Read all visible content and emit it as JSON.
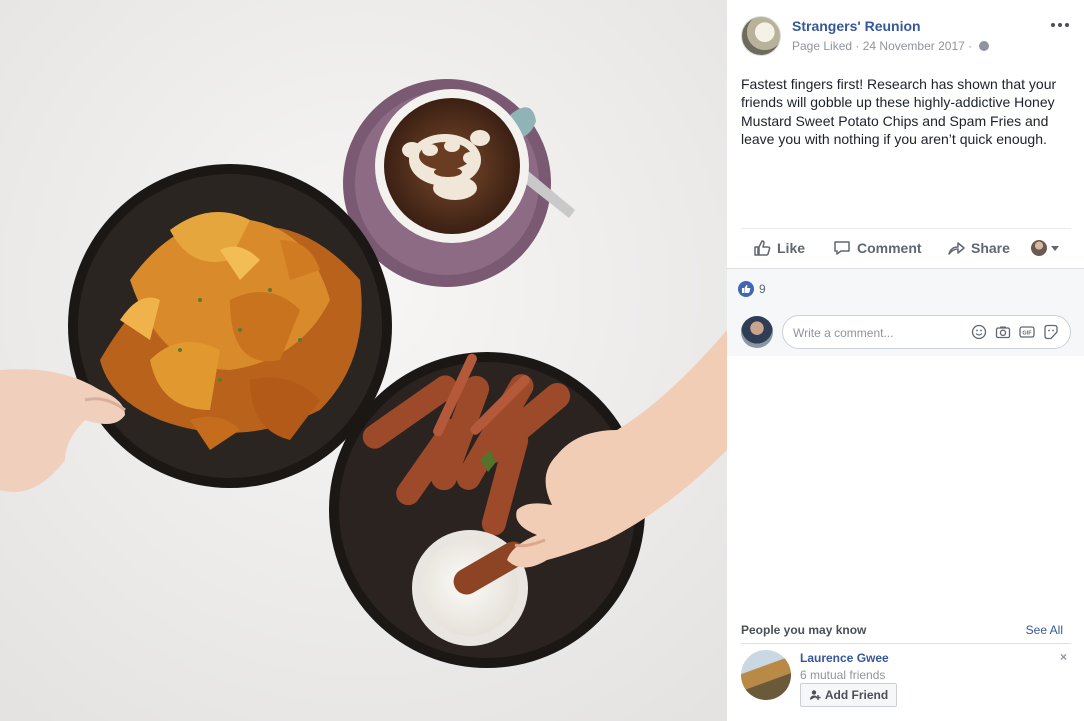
{
  "post": {
    "page_name": "Strangers' Reunion",
    "status": "Page Liked",
    "separator": "·",
    "date": "24 November 2017",
    "more_icon": "more-dots-icon",
    "text": "Fastest fingers first! Research has shown that your friends will gobble up these highly-addictive Honey Mustard Sweet Potato Chips and Spam Fries and leave you with nothing if you aren’t quick enough."
  },
  "actions": {
    "like": "Like",
    "comment": "Comment",
    "share": "Share"
  },
  "reactions": {
    "count": "9",
    "icon": "like-icon",
    "color": "#4267b2"
  },
  "comment_box": {
    "placeholder": "Write a comment...",
    "icons": [
      "emoji-icon",
      "camera-icon",
      "gif-icon",
      "sticker-icon"
    ]
  },
  "people_you_may_know": {
    "title": "People you may know",
    "see_all": "See All",
    "people": [
      {
        "name": "Laurence Gwee",
        "mutual": "6 mutual friends",
        "button": "Add Friend",
        "dismiss": "×"
      }
    ]
  },
  "colors": {
    "link": "#365899",
    "muted": "#90949c",
    "feedback_bg": "#f6f7f9"
  }
}
